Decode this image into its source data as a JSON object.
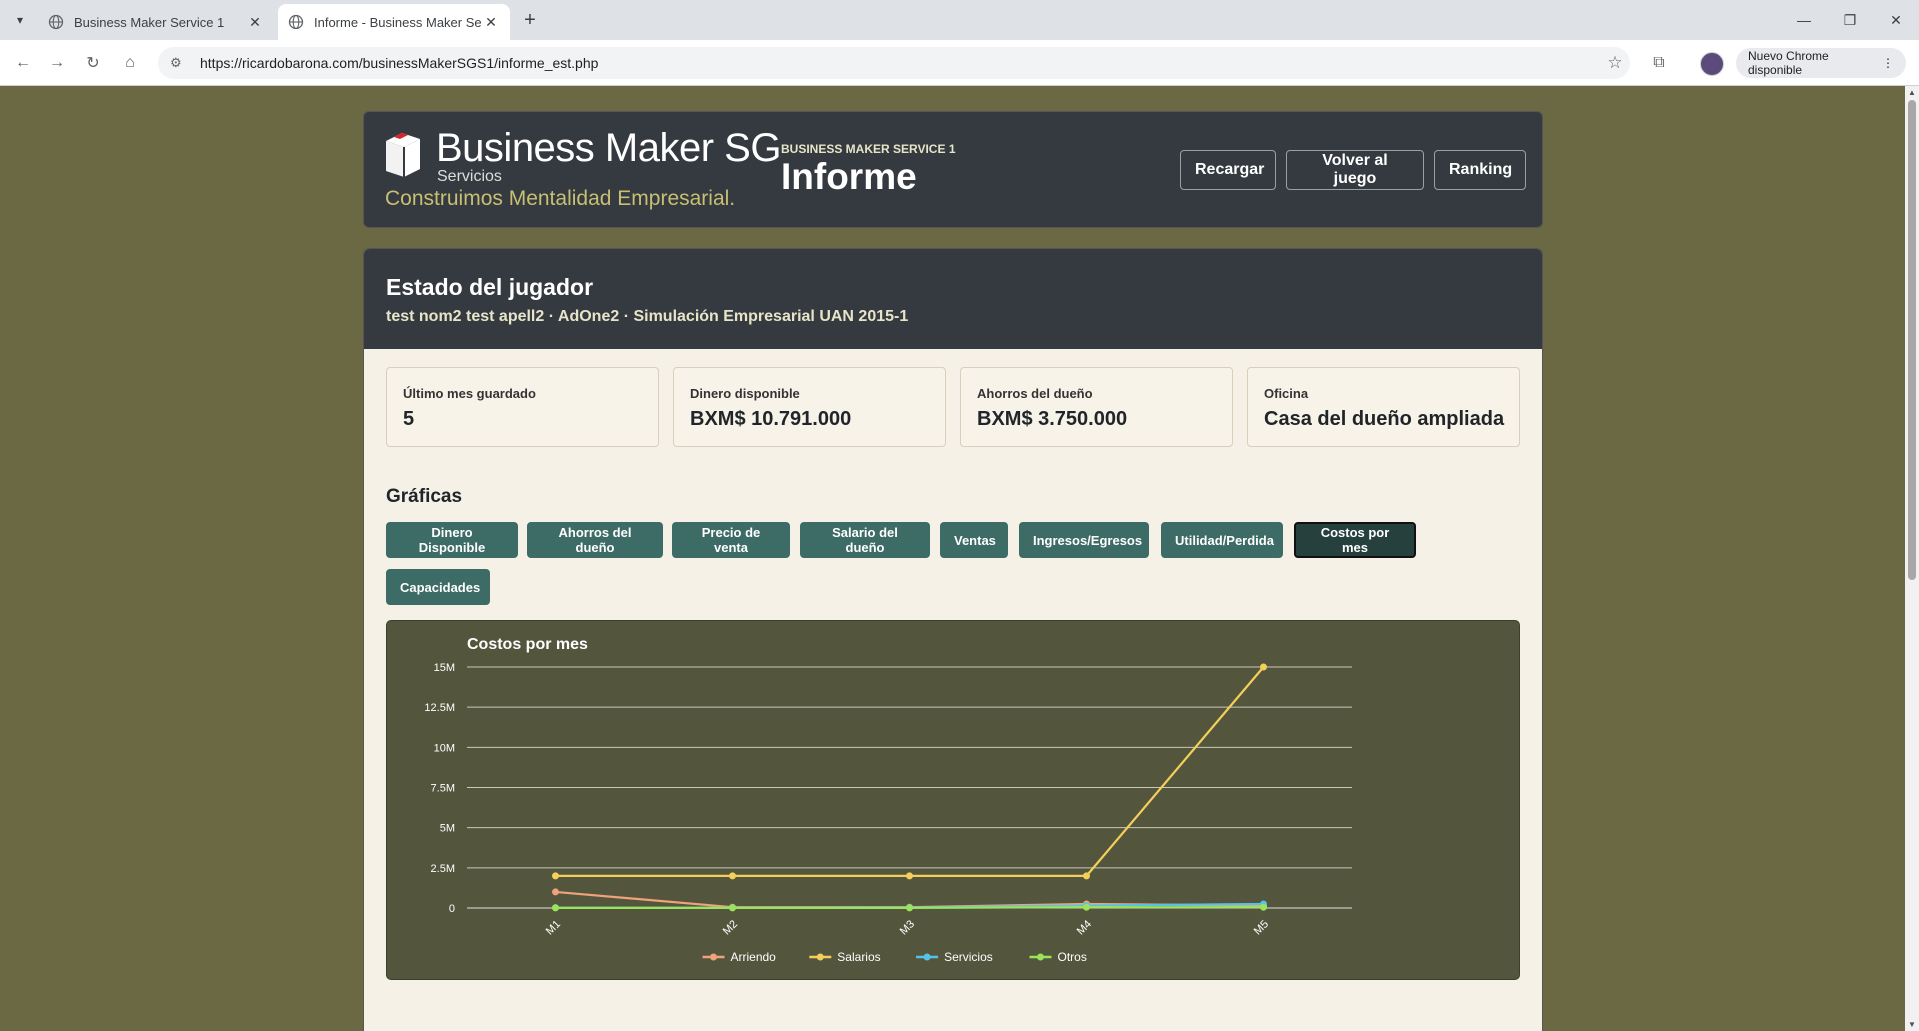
{
  "browser": {
    "tabs": [
      {
        "title": "Business Maker Service 1",
        "active": false
      },
      {
        "title": "Informe - Business Maker Servi",
        "active": true
      }
    ],
    "url": "https://ricardobarona.com/businessMakerSGS1/informe_est.php",
    "update_label": "Nuevo Chrome disponible"
  },
  "header": {
    "brand_name": "Business Maker SG",
    "brand_sub": "Servicios",
    "brand_tag": "Construimos Mentalidad Empresarial.",
    "app_small": "BUSINESS MAKER SERVICE 1",
    "app_big": "Informe",
    "buttons": {
      "reload": "Recargar",
      "back": "Volver al juego",
      "ranking": "Ranking"
    }
  },
  "player": {
    "title": "Estado del jugador",
    "subtitle": "test nom2 test apell2 · AdOne2 · Simulación Empresarial UAN 2015-1",
    "stats": [
      {
        "label": "Último mes guardado",
        "value": "5"
      },
      {
        "label": "Dinero disponible",
        "value": "BXM$ 10.791.000"
      },
      {
        "label": "Ahorros del dueño",
        "value": "BXM$ 3.750.000"
      },
      {
        "label": "Oficina",
        "value": "Casa del dueño ampliada"
      }
    ]
  },
  "graficas": {
    "title": "Gráficas",
    "buttons": [
      "Dinero Disponible",
      "Ahorros del dueño",
      "Precio de venta",
      "Salario del dueño",
      "Ventas",
      "Ingresos/Egresos",
      "Utilidad/Perdida",
      "Costos por mes",
      "Capacidades"
    ],
    "active": "Costos por mes"
  },
  "colors": {
    "accent_btn": "#3d6b66",
    "bg": "#6b6844",
    "chart_bg": "#53563d"
  },
  "chart_data": {
    "type": "line",
    "title": "Costos por mes",
    "categories": [
      "M1",
      "M2",
      "M3",
      "M4",
      "M5"
    ],
    "y_ticks": [
      0,
      2500000,
      5000000,
      7500000,
      10000000,
      12500000,
      15000000
    ],
    "y_tick_labels": [
      "0",
      "2.5M",
      "5M",
      "7.5M",
      "10M",
      "12.5M",
      "15M"
    ],
    "ylim": [
      0,
      15000000
    ],
    "grid": true,
    "legend": "bottom",
    "series": [
      {
        "name": "Arriendo",
        "color": "#f0a27a",
        "values": [
          1000000,
          50000,
          50000,
          250000,
          150000
        ]
      },
      {
        "name": "Salarios",
        "color": "#f4cf5a",
        "values": [
          2000000,
          2000000,
          2000000,
          2000000,
          15000000
        ]
      },
      {
        "name": "Servicios",
        "color": "#55c3e8",
        "values": [
          20000,
          20000,
          30000,
          150000,
          250000
        ]
      },
      {
        "name": "Otros",
        "color": "#9ae35a",
        "values": [
          10000,
          10000,
          10000,
          50000,
          50000
        ]
      }
    ]
  }
}
